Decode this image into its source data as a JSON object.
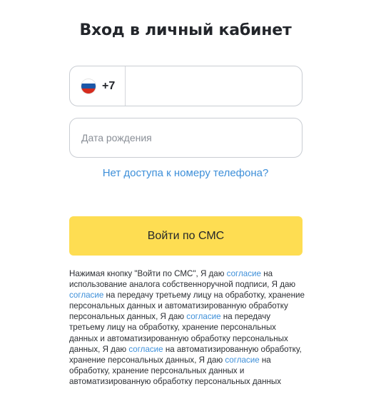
{
  "page": {
    "title": "Вход в личный кабинет"
  },
  "phone": {
    "country_flag": "russia-flag-icon",
    "country_code": "+7",
    "value": "",
    "placeholder": ""
  },
  "birth_date": {
    "value": "",
    "placeholder": "Дата рождения"
  },
  "no_access_link": "Нет доступа к номеру телефона?",
  "submit_label": "Войти по СМС",
  "consent": {
    "intro": "Нажимая кнопку \"Войти по СМС\", Я даю ",
    "link": "согласие",
    "part1": " на использование аналога собственноручной подписи, Я даю ",
    "part2": " на передачу третьему лицу на обработку, хранение персональных данных и автоматизированную обработку персональных данных, Я даю ",
    "part3": " на передачу третьему лицу на обработку, хранение персональных данных и автоматизированную обработку персональных данных, Я даю ",
    "part4": " на автоматизированную обработку, хранение персональных данных, Я даю ",
    "part5": " на обработку, хранение персональных данных и автоматизированную обработку персональных данных"
  },
  "colors": {
    "accent_yellow": "#fedd52",
    "link_blue": "#3d8fd9",
    "flag_white": "#ffffff",
    "flag_blue": "#1c57a8",
    "flag_red": "#d52b1e"
  }
}
